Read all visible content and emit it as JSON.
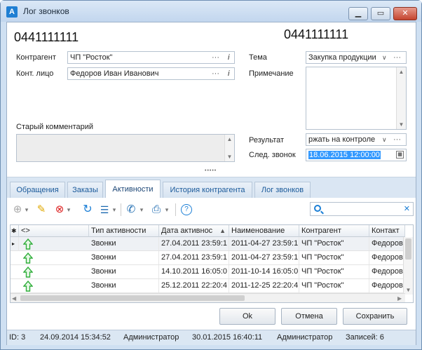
{
  "window": {
    "title": "Лог звонков",
    "icon": "A",
    "minimize": "▁",
    "maximize": "▭",
    "close": "✕"
  },
  "header": {
    "phone_left": "0441111111",
    "phone_right": "0441111111"
  },
  "form": {
    "contractor_label": "Контрагент",
    "contractor_value": "ЧП \"Росток\"",
    "contact_label": "Конт. лицо",
    "contact_value": "Федоров Иван Иванович",
    "topic_label": "Тема",
    "topic_value": "Закупка продукции",
    "note_label": "Примечание",
    "old_comment_label": "Старый комментарий",
    "result_label": "Результат",
    "result_value": "ржать на контроле",
    "next_call_label": "След. звонок",
    "next_call_value": "18.06.2015 12:00:00",
    "dots": "···",
    "info": "i",
    "chevron": "∨",
    "splitter": "•••••"
  },
  "tabs": [
    {
      "label": "Обращения"
    },
    {
      "label": "Заказы"
    },
    {
      "label": "Активности"
    },
    {
      "label": "История контрагента"
    },
    {
      "label": "Лог звонков"
    }
  ],
  "toolbar": {
    "add": "⊕",
    "edit": "✎",
    "delete": "⊗",
    "refresh": "↻",
    "grid": "☰",
    "phone": "✆",
    "print": "⎙",
    "help": "?",
    "clear": "✕",
    "dropdown": "▾"
  },
  "grid": {
    "columns": [
      "<>",
      "Тип активности",
      "Дата активнос",
      "Наименование",
      "Контрагент",
      "Контакт"
    ],
    "rows": [
      [
        "Звонки",
        "27.04.2011 23:59:1",
        "2011-04-27 23:59:1",
        "ЧП \"Росток\"",
        "Федоров"
      ],
      [
        "Звонки",
        "27.04.2011 23:59:1",
        "2011-04-27 23:59:1",
        "ЧП \"Росток\"",
        "Федоров"
      ],
      [
        "Звонки",
        "14.10.2011 16:05:0",
        "2011-10-14 16:05:0",
        "ЧП \"Росток\"",
        "Федоров"
      ],
      [
        "Звонки",
        "25.12.2011 22:20:4",
        "2011-12-25 22:20:4",
        "ЧП \"Росток\"",
        "Федоров"
      ]
    ],
    "row_marker": "▸",
    "star": "✱",
    "sort": "▲"
  },
  "buttons": {
    "ok": "Ok",
    "cancel": "Отмена",
    "save": "Сохранить"
  },
  "status": {
    "id": "ID: 3",
    "created": "24.09.2014 15:34:52",
    "created_by": "Администратор",
    "modified": "30.01.2015 16:40:11",
    "modified_by": "Администратор",
    "records": "Записей: 6"
  },
  "colors": {
    "accent": "#1f7fd3",
    "arrow": "#2fae3a",
    "selection": "#3399ff"
  }
}
